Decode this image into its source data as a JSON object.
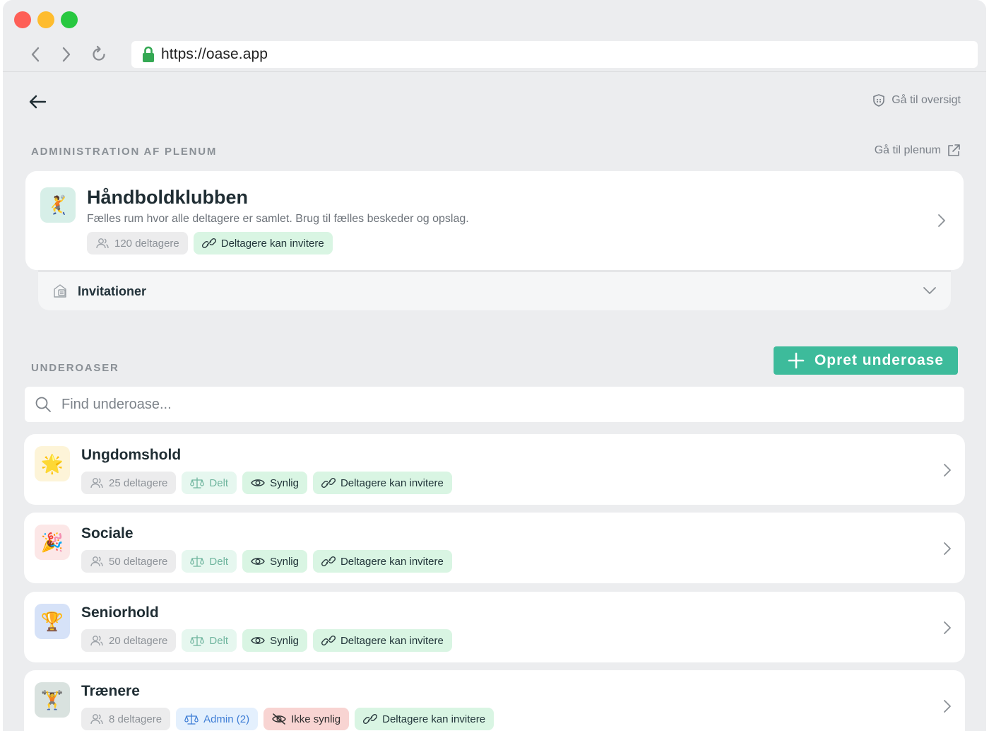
{
  "browser": {
    "url": "https://oase.app"
  },
  "header": {
    "overview_link": "Gå til oversigt"
  },
  "plenum": {
    "section_title": "ADMINISTRATION AF PLENUM",
    "go_link": "Gå til plenum",
    "card": {
      "emoji": "🤾",
      "avatar_color": "#d7efe8",
      "title": "Håndboldklubben",
      "description": "Fælles rum hvor alle deltagere er samlet. Brug til fælles beskeder og opslag.",
      "participants": "120 deltagere",
      "invite_chip": "Deltagere kan invitere"
    },
    "invitations_label": "Invitationer"
  },
  "sub": {
    "section_title": "UNDEROASER",
    "create_button": "Opret underoase",
    "search_placeholder": "Find underoase...",
    "items": [
      {
        "emoji": "🌟",
        "avatar_color": "#fdf4d8",
        "title": "Ungdomshold",
        "participants": "25 deltagere",
        "shared": "Delt",
        "visible": "Synlig",
        "invite": "Deltagere kan invitere"
      },
      {
        "emoji": "🎉",
        "avatar_color": "#fce7e7",
        "title": "Sociale",
        "participants": "50 deltagere",
        "shared": "Delt",
        "visible": "Synlig",
        "invite": "Deltagere kan invitere"
      },
      {
        "emoji": "🏆",
        "avatar_color": "#d6e2f8",
        "title": "Seniorhold",
        "participants": "20 deltagere",
        "shared": "Delt",
        "visible": "Synlig",
        "invite": "Deltagere kan invitere"
      },
      {
        "emoji": "🏋",
        "avatar_color": "#d9e2df",
        "title": "Trænere",
        "participants": "8 deltagere",
        "admin": "Admin (2)",
        "hidden": "Ikke synlig",
        "invite": "Deltagere kan invitere"
      }
    ]
  },
  "colors": {
    "accent": "#3dbb9b",
    "background": "#ecedef"
  }
}
